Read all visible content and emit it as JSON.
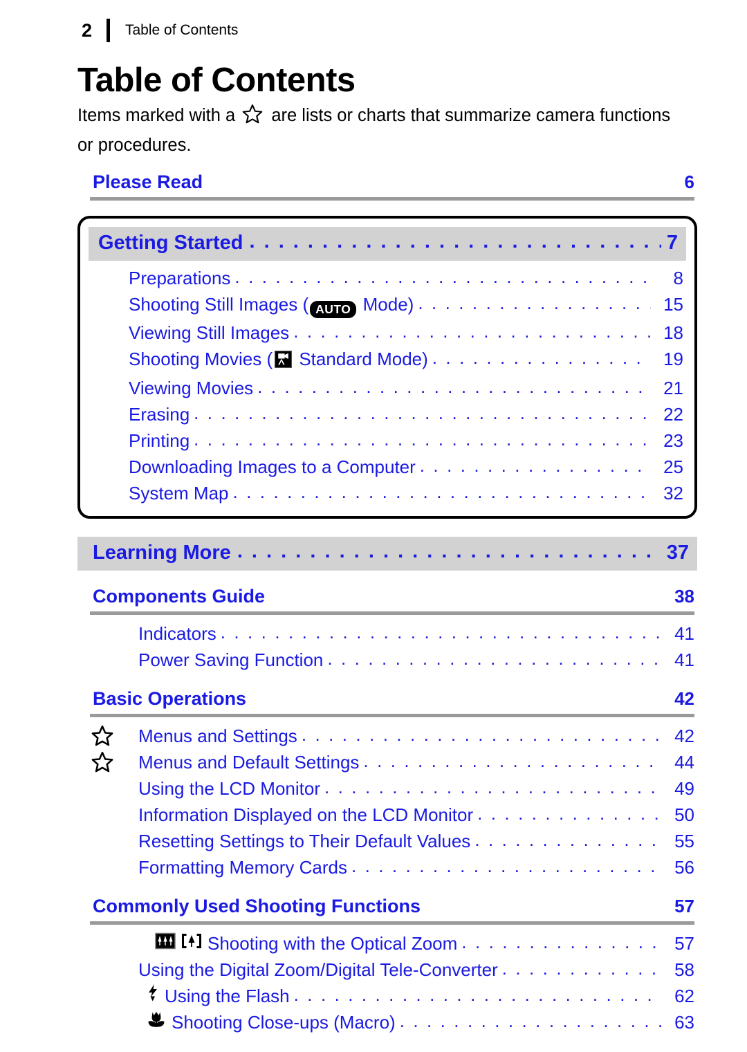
{
  "header": {
    "folio": "2",
    "title": "Table of Contents"
  },
  "title": "Table of Contents",
  "intro": {
    "before_star": "Items marked with a",
    "after_star": "are lists or charts that summarize camera functions or procedures.",
    "star_icon": "star-icon"
  },
  "colors": {
    "link_blue": "#1a1ae2",
    "band_gray": "#d2d2d2",
    "rule_gray": "#9a9a9a",
    "text_black": "#000000"
  },
  "sections": [
    {
      "kind": "plain-head",
      "name": "please-read",
      "label": "Please Read",
      "page": "6"
    },
    {
      "kind": "boxed",
      "name": "getting-started",
      "band": {
        "label": "Getting Started",
        "page": "7"
      },
      "entries": [
        {
          "text": "Preparations",
          "page": "8",
          "icon": ""
        },
        {
          "text_a": "Shooting Still Images (",
          "badge": "AUTO",
          "text_b": " Mode)",
          "page": "15",
          "icon": "auto-badge"
        },
        {
          "text": "Viewing Still Images",
          "page": "18",
          "icon": ""
        },
        {
          "text_a": "Shooting Movies (",
          "text_b": " Standard Mode)",
          "page": "19",
          "icon": "movie-mode-icon"
        },
        {
          "text": "Viewing Movies",
          "page": "21",
          "icon": ""
        },
        {
          "text": "Erasing",
          "page": "22",
          "icon": ""
        },
        {
          "text": "Printing",
          "page": "23",
          "icon": ""
        },
        {
          "text": "Downloading Images to a Computer",
          "page": "25",
          "icon": ""
        },
        {
          "text": "System Map",
          "page": "32",
          "icon": ""
        }
      ]
    },
    {
      "kind": "band",
      "name": "learning-more",
      "label": "Learning More",
      "page": "37"
    },
    {
      "kind": "plain-head",
      "name": "components-guide",
      "label": "Components Guide",
      "page": "38",
      "entries": [
        {
          "text": "Indicators",
          "page": "41",
          "star": false
        },
        {
          "text": "Power Saving Function",
          "page": "41",
          "star": false
        }
      ]
    },
    {
      "kind": "plain-head",
      "name": "basic-operations",
      "label": "Basic Operations",
      "page": "42",
      "entries": [
        {
          "text": "Menus and Settings",
          "page": "42",
          "star": true
        },
        {
          "text": "Menus and Default Settings",
          "page": "44",
          "star": true
        },
        {
          "text": "Using the LCD Monitor",
          "page": "49",
          "star": false
        },
        {
          "text": "Information Displayed on the LCD Monitor",
          "page": "50",
          "star": false
        },
        {
          "text": "Resetting Settings to Their Default Values",
          "page": "55",
          "star": false
        },
        {
          "text": "Formatting Memory Cards",
          "page": "56",
          "star": false
        }
      ]
    },
    {
      "kind": "plain-head",
      "name": "commonly-used-shooting-functions",
      "label": "Commonly Used Shooting Functions",
      "page": "57",
      "entries": [
        {
          "text": "Shooting with the Optical Zoom",
          "page": "57",
          "icons": [
            "wide-angle-zoom-icon",
            "telephoto-zoom-icon"
          ]
        },
        {
          "text": "Using the Digital Zoom/Digital Tele-Converter",
          "page": "58",
          "icons": []
        },
        {
          "text": "Using the Flash",
          "page": "62",
          "icons": [
            "flash-icon"
          ]
        },
        {
          "text": "Shooting Close-ups (Macro)",
          "page": "63",
          "icons": [
            "macro-flower-icon"
          ]
        }
      ]
    }
  ],
  "leader": ". . . . . . . . . . . . . . . . . . . . . . . . . . . . . . . . . . . . . . . . . . . . . . . . . . . . . . . . . . . . . ."
}
